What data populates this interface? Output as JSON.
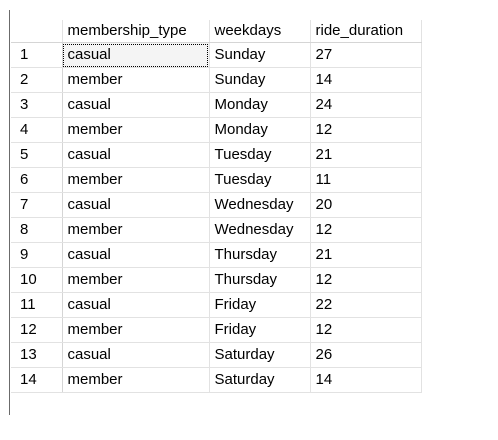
{
  "results": {
    "columns": [
      "membership_type",
      "weekdays",
      "ride_duration"
    ],
    "rows": [
      {
        "n": "1",
        "membership_type": "casual",
        "weekdays": "Sunday",
        "ride_duration": "27"
      },
      {
        "n": "2",
        "membership_type": "member",
        "weekdays": "Sunday",
        "ride_duration": "14"
      },
      {
        "n": "3",
        "membership_type": "casual",
        "weekdays": "Monday",
        "ride_duration": "24"
      },
      {
        "n": "4",
        "membership_type": "member",
        "weekdays": "Monday",
        "ride_duration": "12"
      },
      {
        "n": "5",
        "membership_type": "casual",
        "weekdays": "Tuesday",
        "ride_duration": "21"
      },
      {
        "n": "6",
        "membership_type": "member",
        "weekdays": "Tuesday",
        "ride_duration": "11"
      },
      {
        "n": "7",
        "membership_type": "casual",
        "weekdays": "Wednesday",
        "ride_duration": "20"
      },
      {
        "n": "8",
        "membership_type": "member",
        "weekdays": "Wednesday",
        "ride_duration": "12"
      },
      {
        "n": "9",
        "membership_type": "casual",
        "weekdays": "Thursday",
        "ride_duration": "21"
      },
      {
        "n": "10",
        "membership_type": "member",
        "weekdays": "Thursday",
        "ride_duration": "12"
      },
      {
        "n": "11",
        "membership_type": "casual",
        "weekdays": "Friday",
        "ride_duration": "22"
      },
      {
        "n": "12",
        "membership_type": "member",
        "weekdays": "Friday",
        "ride_duration": "12"
      },
      {
        "n": "13",
        "membership_type": "casual",
        "weekdays": "Saturday",
        "ride_duration": "26"
      },
      {
        "n": "14",
        "membership_type": "member",
        "weekdays": "Saturday",
        "ride_duration": "14"
      }
    ]
  }
}
